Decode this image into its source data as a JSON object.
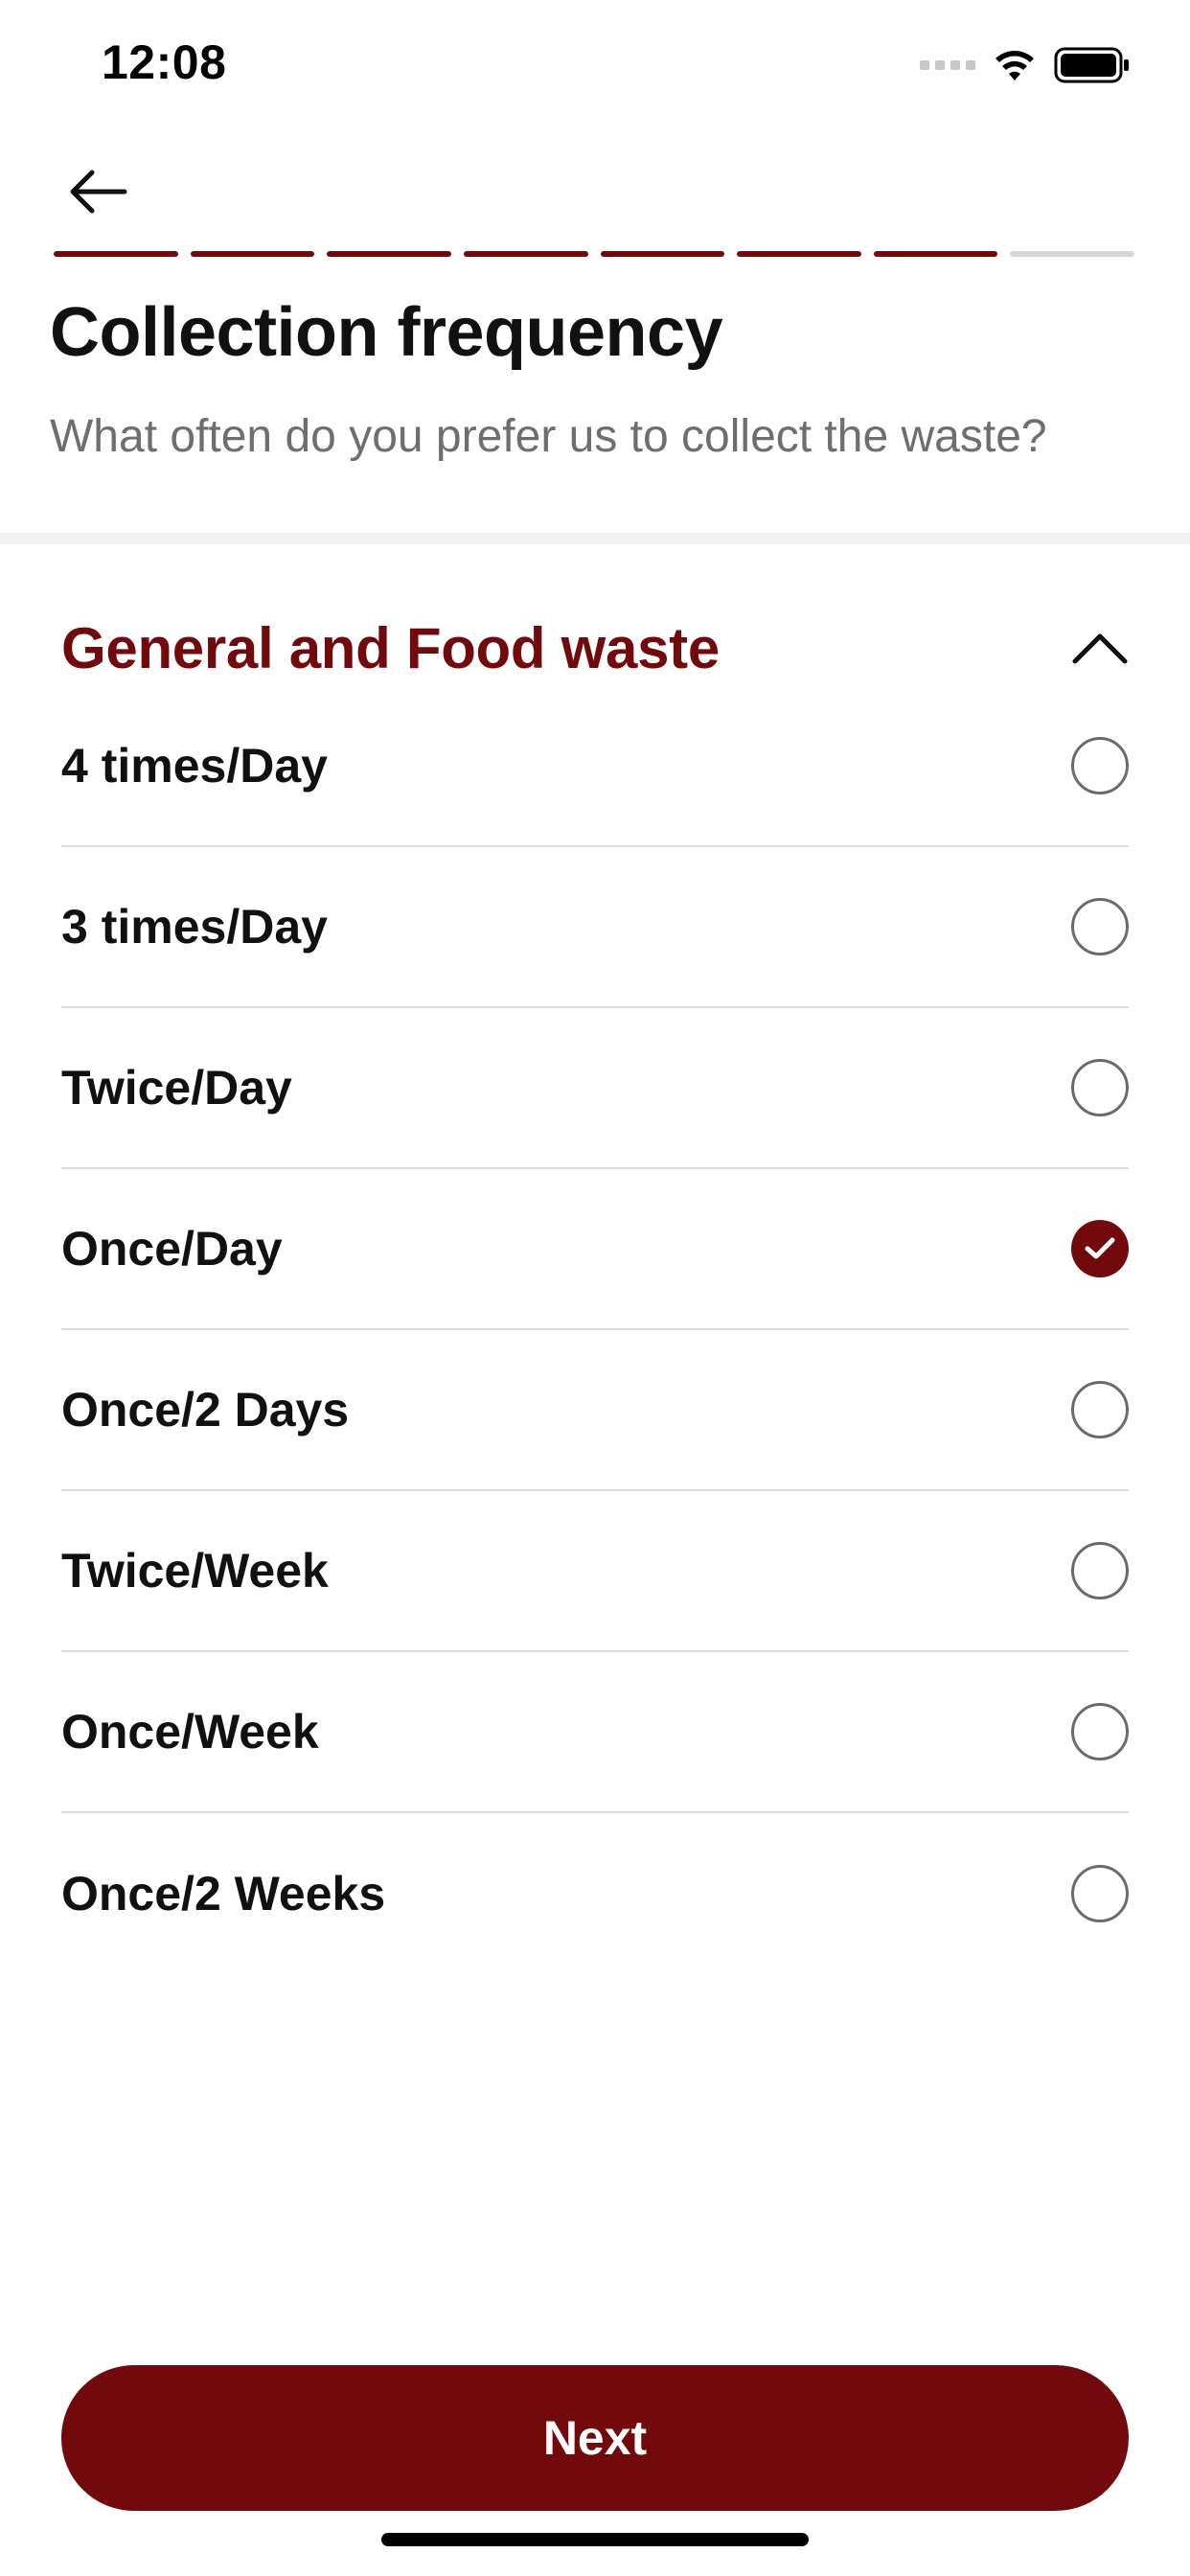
{
  "colors": {
    "accent": "#720a0d",
    "progress_inactive": "#d6d6d6",
    "subtitle": "#6e6e6e"
  },
  "status_bar": {
    "time": "12:08",
    "icons": [
      "signal-icon",
      "wifi-icon",
      "battery-icon"
    ]
  },
  "header": {
    "back_icon": "arrow-left-icon",
    "progress": {
      "total_steps": 8,
      "completed_steps": 7
    }
  },
  "page": {
    "title": "Collection frequency",
    "subtitle": "What often do you prefer us to collect the waste?"
  },
  "section": {
    "title": "General and Food waste",
    "expanded": true,
    "toggle_icon": "chevron-up-icon",
    "options": [
      {
        "label": "4 times/Day",
        "selected": false
      },
      {
        "label": "3 times/Day",
        "selected": false
      },
      {
        "label": "Twice/Day",
        "selected": false
      },
      {
        "label": "Once/Day",
        "selected": true
      },
      {
        "label": "Once/2 Days",
        "selected": false
      },
      {
        "label": "Twice/Week",
        "selected": false
      },
      {
        "label": "Once/Week",
        "selected": false
      },
      {
        "label": "Once/2 Weeks",
        "selected": false
      }
    ]
  },
  "footer": {
    "next_label": "Next"
  }
}
